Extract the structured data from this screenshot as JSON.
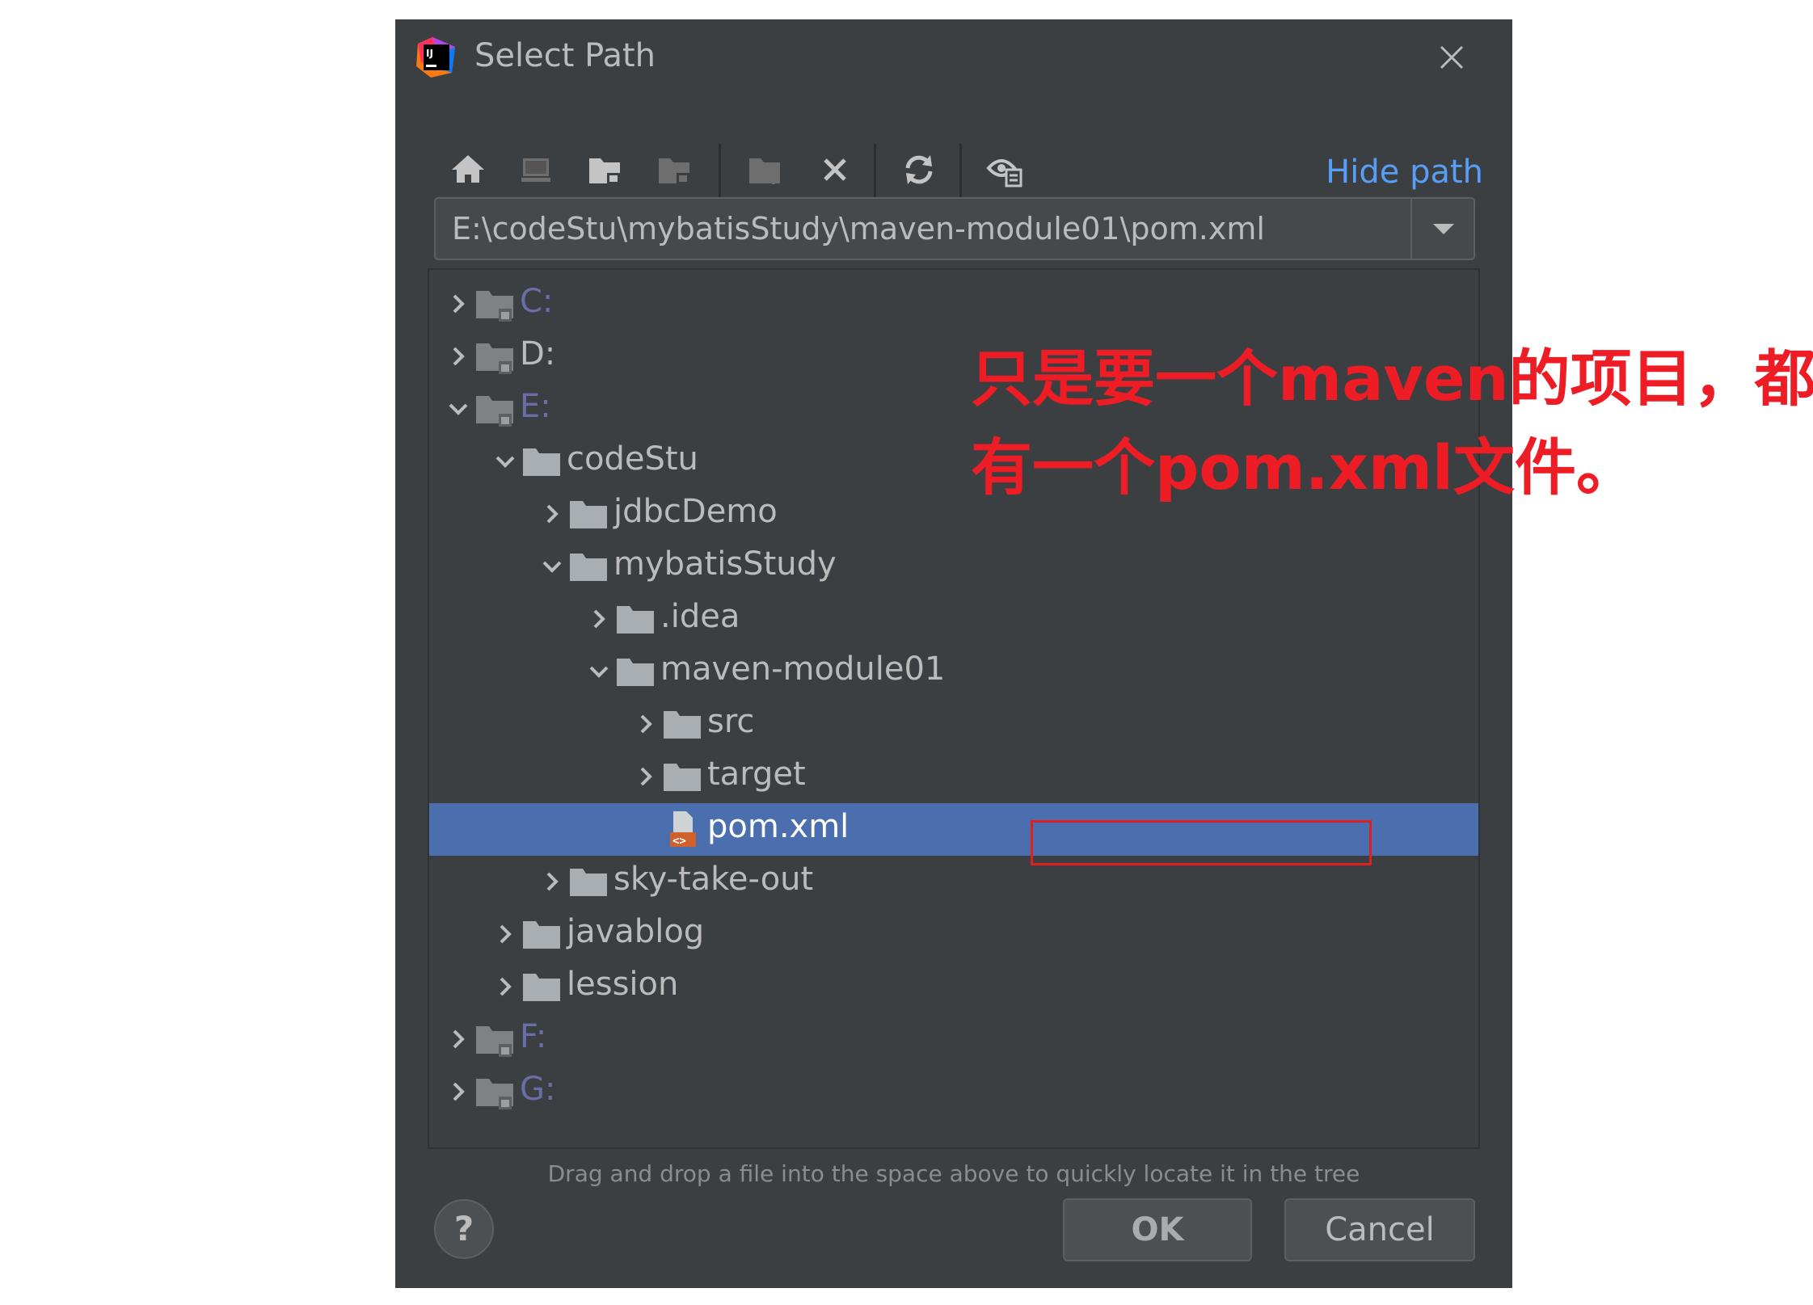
{
  "window": {
    "title": "Select Path",
    "icon": "intellij-idea-icon",
    "close_icon": "close-icon"
  },
  "toolbar": {
    "icons": [
      "home-icon",
      "desktop-icon",
      "project-folder-icon",
      "module-folder-icon",
      "new-folder-icon",
      "delete-icon",
      "refresh-icon",
      "show-hidden-files-icon"
    ],
    "hide_path_label": "Hide path"
  },
  "path": {
    "value": "E:\\codeStu\\mybatisStudy\\maven-module01\\pom.xml"
  },
  "tree": {
    "items": [
      {
        "label": "C:",
        "expanded": false,
        "type": "drive"
      },
      {
        "label": "D:",
        "expanded": false,
        "type": "drive"
      },
      {
        "label": "E:",
        "expanded": true,
        "type": "drive"
      },
      {
        "label": "codeStu",
        "expanded": true,
        "type": "folder"
      },
      {
        "label": "jdbcDemo",
        "expanded": false,
        "type": "folder"
      },
      {
        "label": "mybatisStudy",
        "expanded": true,
        "type": "folder"
      },
      {
        "label": ".idea",
        "expanded": false,
        "type": "folder"
      },
      {
        "label": "maven-module01",
        "expanded": true,
        "type": "folder"
      },
      {
        "label": "src",
        "expanded": false,
        "type": "folder"
      },
      {
        "label": "target",
        "expanded": false,
        "type": "folder"
      },
      {
        "label": "pom.xml",
        "type": "file",
        "selected": true
      },
      {
        "label": "sky-take-out",
        "expanded": false,
        "type": "folder"
      },
      {
        "label": "javablog",
        "expanded": false,
        "type": "folder"
      },
      {
        "label": "lession",
        "expanded": false,
        "type": "folder"
      },
      {
        "label": "F:",
        "expanded": false,
        "type": "drive"
      },
      {
        "label": "G:",
        "expanded": false,
        "type": "drive"
      }
    ]
  },
  "hint": "Drag and drop a file into the space above to quickly locate it in the tree",
  "buttons": {
    "help": "?",
    "ok": "OK",
    "cancel": "Cancel"
  },
  "annotation": {
    "line1": "只是要一个maven的项目，都",
    "line2": "有一个pom.xml文件。"
  },
  "colors": {
    "dialog_bg": "#3c3f41",
    "selection": "#4b6eaf",
    "link": "#589df6",
    "annotation": "#ee1c25",
    "highlight_box": "#e02020"
  }
}
